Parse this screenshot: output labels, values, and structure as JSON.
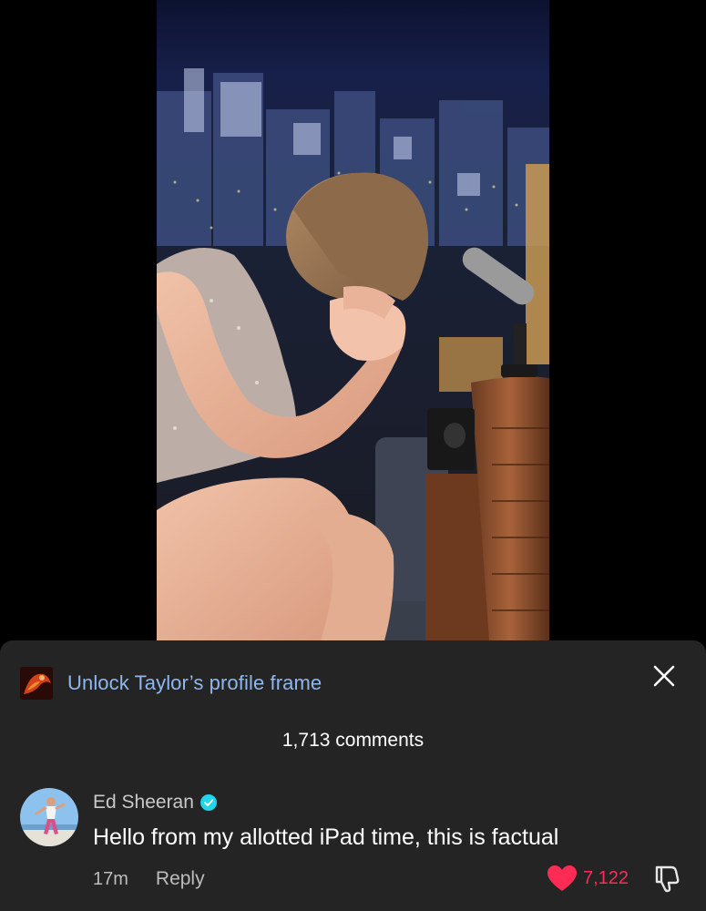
{
  "promo": {
    "text": "Unlock Taylor’s profile frame",
    "thumb_icon": "profile-frame-thumbnail"
  },
  "close": {
    "icon": "close-icon"
  },
  "comments": {
    "count_label": "1,713 comments"
  },
  "comment": {
    "author": "Ed Sheeran",
    "verified": true,
    "text": "Hello from my allotted iPad time, this is factual",
    "time": "17m",
    "reply_label": "Reply",
    "likes": "7,122",
    "liked": true
  },
  "colors": {
    "sheet_bg": "#242424",
    "link_blue": "#8fb7ef",
    "like_red": "#fe2c55",
    "verified_blue": "#20d5ec"
  }
}
